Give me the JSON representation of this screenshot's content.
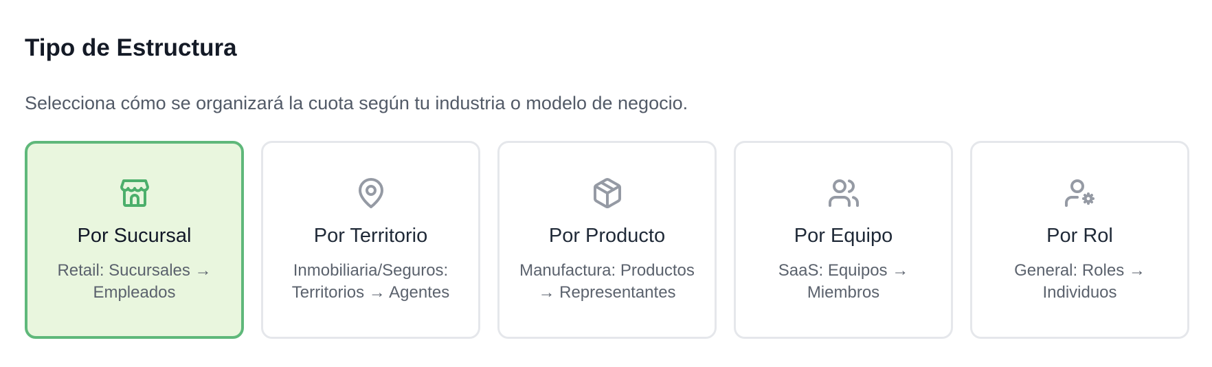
{
  "section": {
    "title": "Tipo de Estructura",
    "subtitle": "Selecciona cómo se organizará la cuota según tu industria o modelo de negocio."
  },
  "options": [
    {
      "icon": "store-icon",
      "title": "Por Sucursal",
      "description": "Retail: Sucursales → Empleados",
      "selected": true
    },
    {
      "icon": "map-pin-icon",
      "title": "Por Territorio",
      "description": "Inmobiliaria/Seguros: Territorios → Agentes",
      "selected": false
    },
    {
      "icon": "package-icon",
      "title": "Por Producto",
      "description": "Manufactura: Productos → Representantes",
      "selected": false
    },
    {
      "icon": "users-icon",
      "title": "Por Equipo",
      "description": "SaaS: Equipos → Miembros",
      "selected": false
    },
    {
      "icon": "user-cog-icon",
      "title": "Por Rol",
      "description": "General: Roles → Individuos",
      "selected": false
    }
  ],
  "colors": {
    "selected_border": "#5fb87a",
    "selected_background": "#e9f6de",
    "selected_icon": "#4caf6b",
    "default_border": "#e5e7eb",
    "default_icon": "#959aa4"
  }
}
